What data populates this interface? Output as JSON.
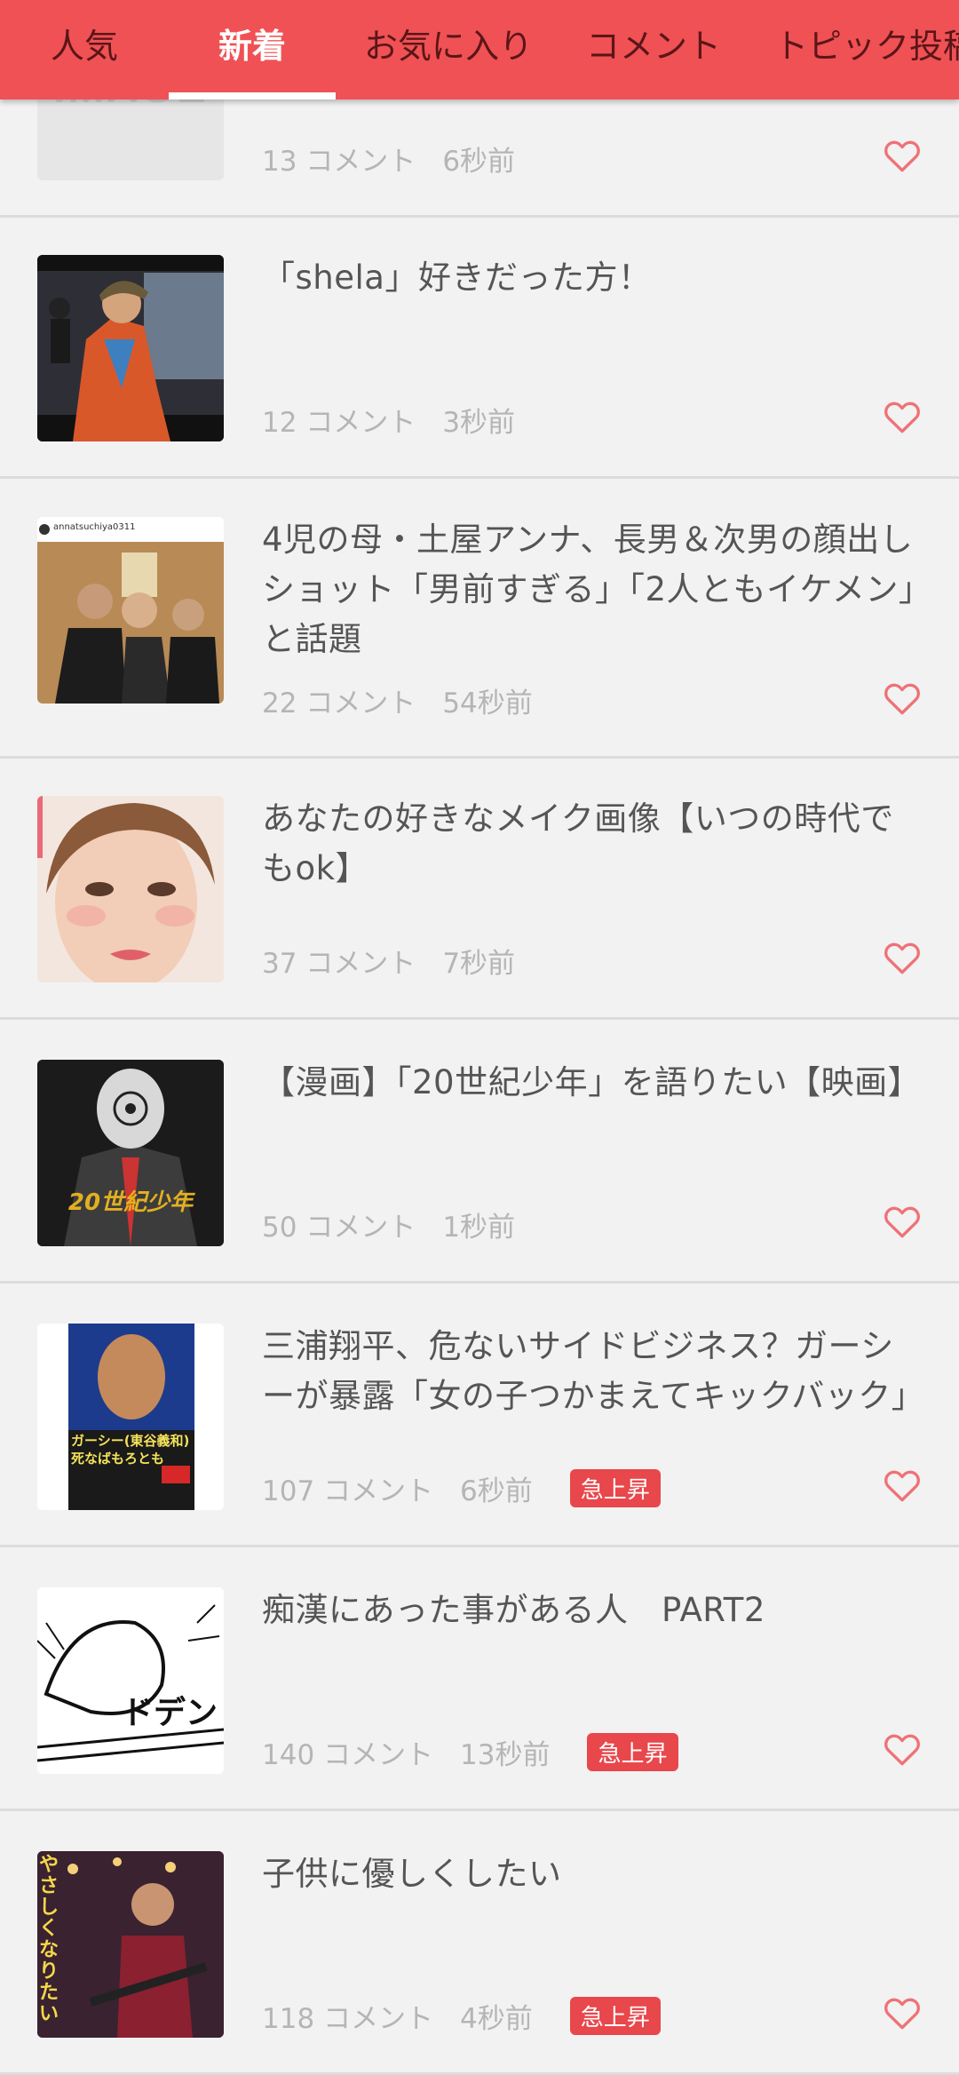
{
  "tabs": [
    {
      "label": "人気",
      "active": false
    },
    {
      "label": "新着",
      "active": true
    },
    {
      "label": "お気に入り",
      "active": false
    },
    {
      "label": "コメント",
      "active": false
    },
    {
      "label": "トピック投稿",
      "active": false
    }
  ],
  "accent_color": "#f05155",
  "badge_color": "#e8474c",
  "topics": [
    {
      "title": "",
      "comments": "13 コメント",
      "time": "6秒前",
      "badge": "",
      "thumb_text": "IMAGE"
    },
    {
      "title": "「shela」好きだった方！",
      "comments": "12 コメント",
      "time": "3秒前",
      "badge": ""
    },
    {
      "title": "4児の母・土屋アンナ、長男＆次男の顔出しショット「男前すぎる」「2人ともイケメン」と話題",
      "comments": "22 コメント",
      "time": "54秒前",
      "badge": "",
      "thumb_text": "annatsuchiya0311"
    },
    {
      "title": "あなたの好きなメイク画像【いつの時代でもok】",
      "comments": "37 コメント",
      "time": "7秒前",
      "badge": ""
    },
    {
      "title": "【漫画】「20世紀少年」を語りたい【映画】",
      "comments": "50 コメント",
      "time": "1秒前",
      "badge": "",
      "thumb_text": "20世紀少年"
    },
    {
      "title": "三浦翔平、危ないサイドビジネス？ガーシーが暴露「女の子つかまえてキックバック」",
      "comments": "107 コメント",
      "time": "6秒前",
      "badge": "急上昇",
      "thumb_text": "ガーシー(東谷義和) 死なばもろとも"
    },
    {
      "title": "痴漢にあった事がある人　PART2",
      "comments": "140 コメント",
      "time": "13秒前",
      "badge": "急上昇",
      "thumb_text": "ドデン"
    },
    {
      "title": "子供に優しくしたい",
      "comments": "118 コメント",
      "time": "4秒前",
      "badge": "急上昇",
      "thumb_text": "やさしくなりたい"
    }
  ]
}
